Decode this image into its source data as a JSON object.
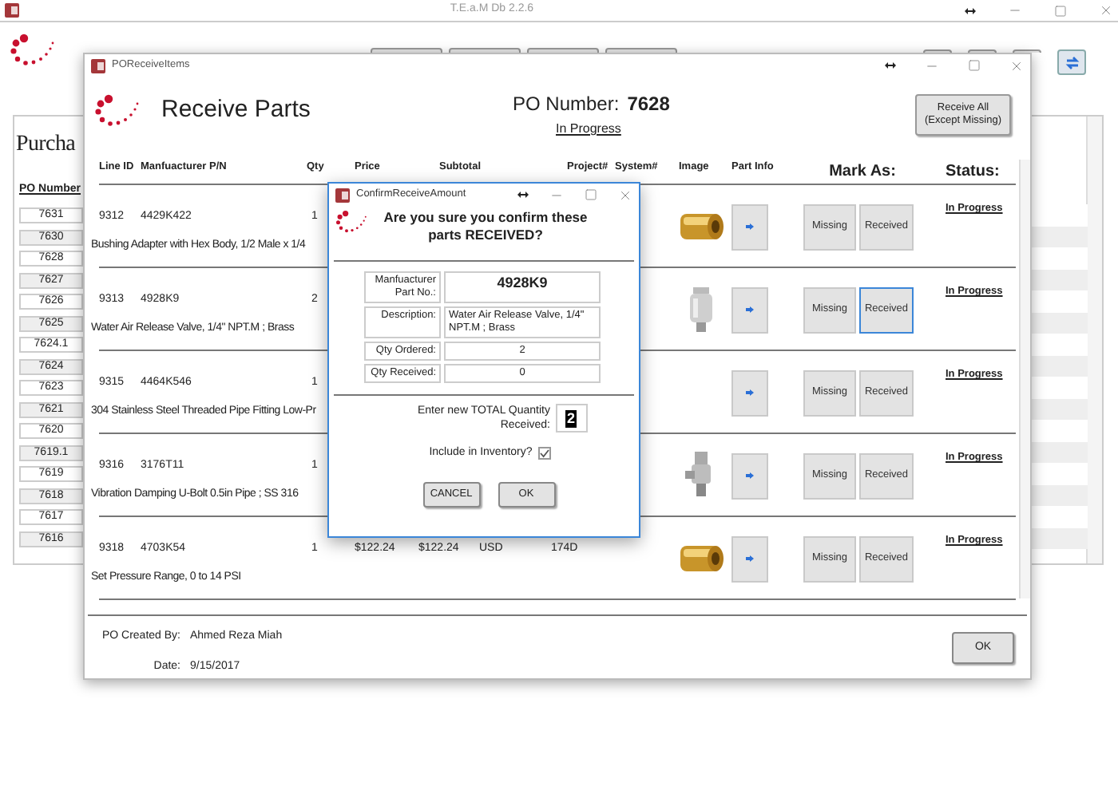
{
  "app_window": {
    "title": "T.E.a.M Db 2.2.6",
    "panel_title": "Purcha",
    "list_header": "PO Number",
    "po_numbers": [
      "7631",
      "7630",
      "7628",
      "7627",
      "7626",
      "7625",
      "7624.1",
      "7624",
      "7623",
      "7621",
      "7620",
      "7619.1",
      "7619",
      "7618",
      "7617",
      "7616"
    ]
  },
  "receive_window": {
    "title": "POReceiveItems",
    "heading": "Receive Parts",
    "po_number_label": "PO Number:",
    "po_number": "7628",
    "status": "In Progress",
    "receive_all_button": [
      "Receive All",
      "(Except Missing)"
    ],
    "columns": [
      "Line ID",
      "Manfuacturer P/N",
      "Qty",
      "Price",
      "Subtotal",
      "Project#",
      "System#",
      "Image",
      "Part Info",
      "Mark As:",
      "Status:"
    ],
    "rows": [
      {
        "line_id": "9312",
        "part_number": "4429K422",
        "qty": "1",
        "description": "Bushing Adapter with Hex Body, 1/2 Male x 1/4",
        "image": true,
        "missing": "Missing",
        "received": "Received",
        "focused": false,
        "status": "In Progress"
      },
      {
        "line_id": "9313",
        "part_number": "4928K9",
        "qty": "2",
        "description": "Water Air Release Valve, 1/4\" NPT.M ; Brass",
        "image": true,
        "missing": "Missing",
        "received": "Received",
        "focused": true,
        "status": "In Progress"
      },
      {
        "line_id": "9315",
        "part_number": "4464K546",
        "qty": "1",
        "description": "304 Stainless Steel Threaded Pipe Fitting Low-Pr",
        "image": false,
        "missing": "Missing",
        "received": "Received",
        "focused": false,
        "status": "In Progress"
      },
      {
        "line_id": "9316",
        "part_number": "3176T11",
        "qty": "1",
        "description": "Vibration Damping U-Bolt 0.5in Pipe ; SS 316",
        "image": true,
        "missing": "Missing",
        "received": "Received",
        "focused": false,
        "status": "In Progress"
      },
      {
        "line_id": "9318",
        "part_number": "4703K54",
        "qty": "1",
        "price": "$122.24",
        "subtotal": "$122.24",
        "currency": "USD",
        "project": "174D",
        "description": "Set Pressure Range, 0 to 14 PSI",
        "image": true,
        "missing": "Missing",
        "received": "Received",
        "focused": false,
        "status": "In Progress"
      }
    ],
    "created_by_label": "PO Created By:",
    "created_by": "Ahmed Reza Miah",
    "date_label": "Date:",
    "date": "9/15/2017",
    "ok_button": "OK"
  },
  "dialog": {
    "title": "ConfirmReceiveAmount",
    "question": "Are you sure you confirm these parts RECEIVED?",
    "fields": [
      {
        "label": "Manfuacturer Part No.:",
        "value": "4928K9",
        "kind": "bold"
      },
      {
        "label": "Description:",
        "value": "Water Air Release Valve, 1/4\" NPT.M ; Brass",
        "kind": "left"
      },
      {
        "label": "Qty Ordered:",
        "value": "2",
        "kind": "center"
      },
      {
        "label": "Qty Received:",
        "value": "0",
        "kind": "center"
      }
    ],
    "entry_label": "Enter new TOTAL Quantity Received:",
    "entry_value": "2",
    "include_label": "Include in Inventory?",
    "include_checked": true,
    "buttons": [
      "CANCEL",
      "OK"
    ]
  }
}
